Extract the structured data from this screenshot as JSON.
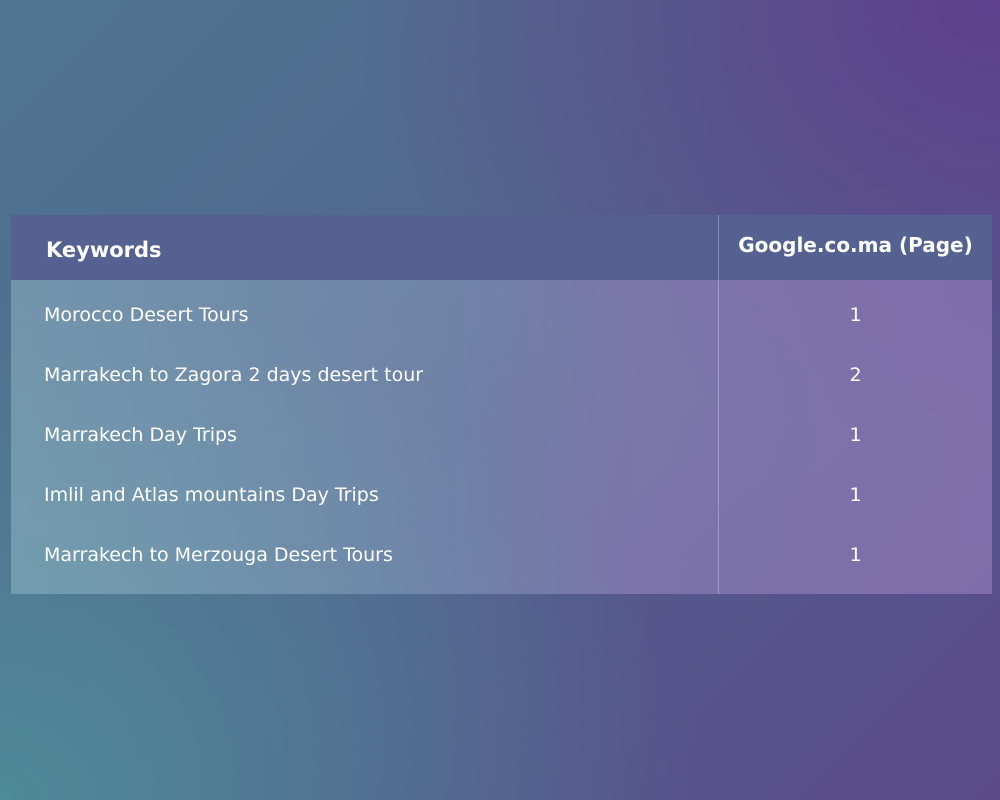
{
  "table": {
    "headers": {
      "keywords": "Keywords",
      "page": "Google.co.ma (Page)"
    },
    "rows": [
      {
        "keyword": "Morocco Desert Tours",
        "page": "1"
      },
      {
        "keyword": "Marrakech to Zagora 2 days desert tour",
        "page": "2"
      },
      {
        "keyword": "Marrakech Day Trips",
        "page": "1"
      },
      {
        "keyword": "Imlil and Atlas mountains Day Trips",
        "page": "1"
      },
      {
        "keyword": "Marrakech to Merzouga Desert Tours",
        "page": "1"
      }
    ]
  },
  "colors": {
    "header_background": "#546191",
    "text": "#ffffff",
    "background_teal": "#4e8c98",
    "background_purple": "#5e408c"
  }
}
